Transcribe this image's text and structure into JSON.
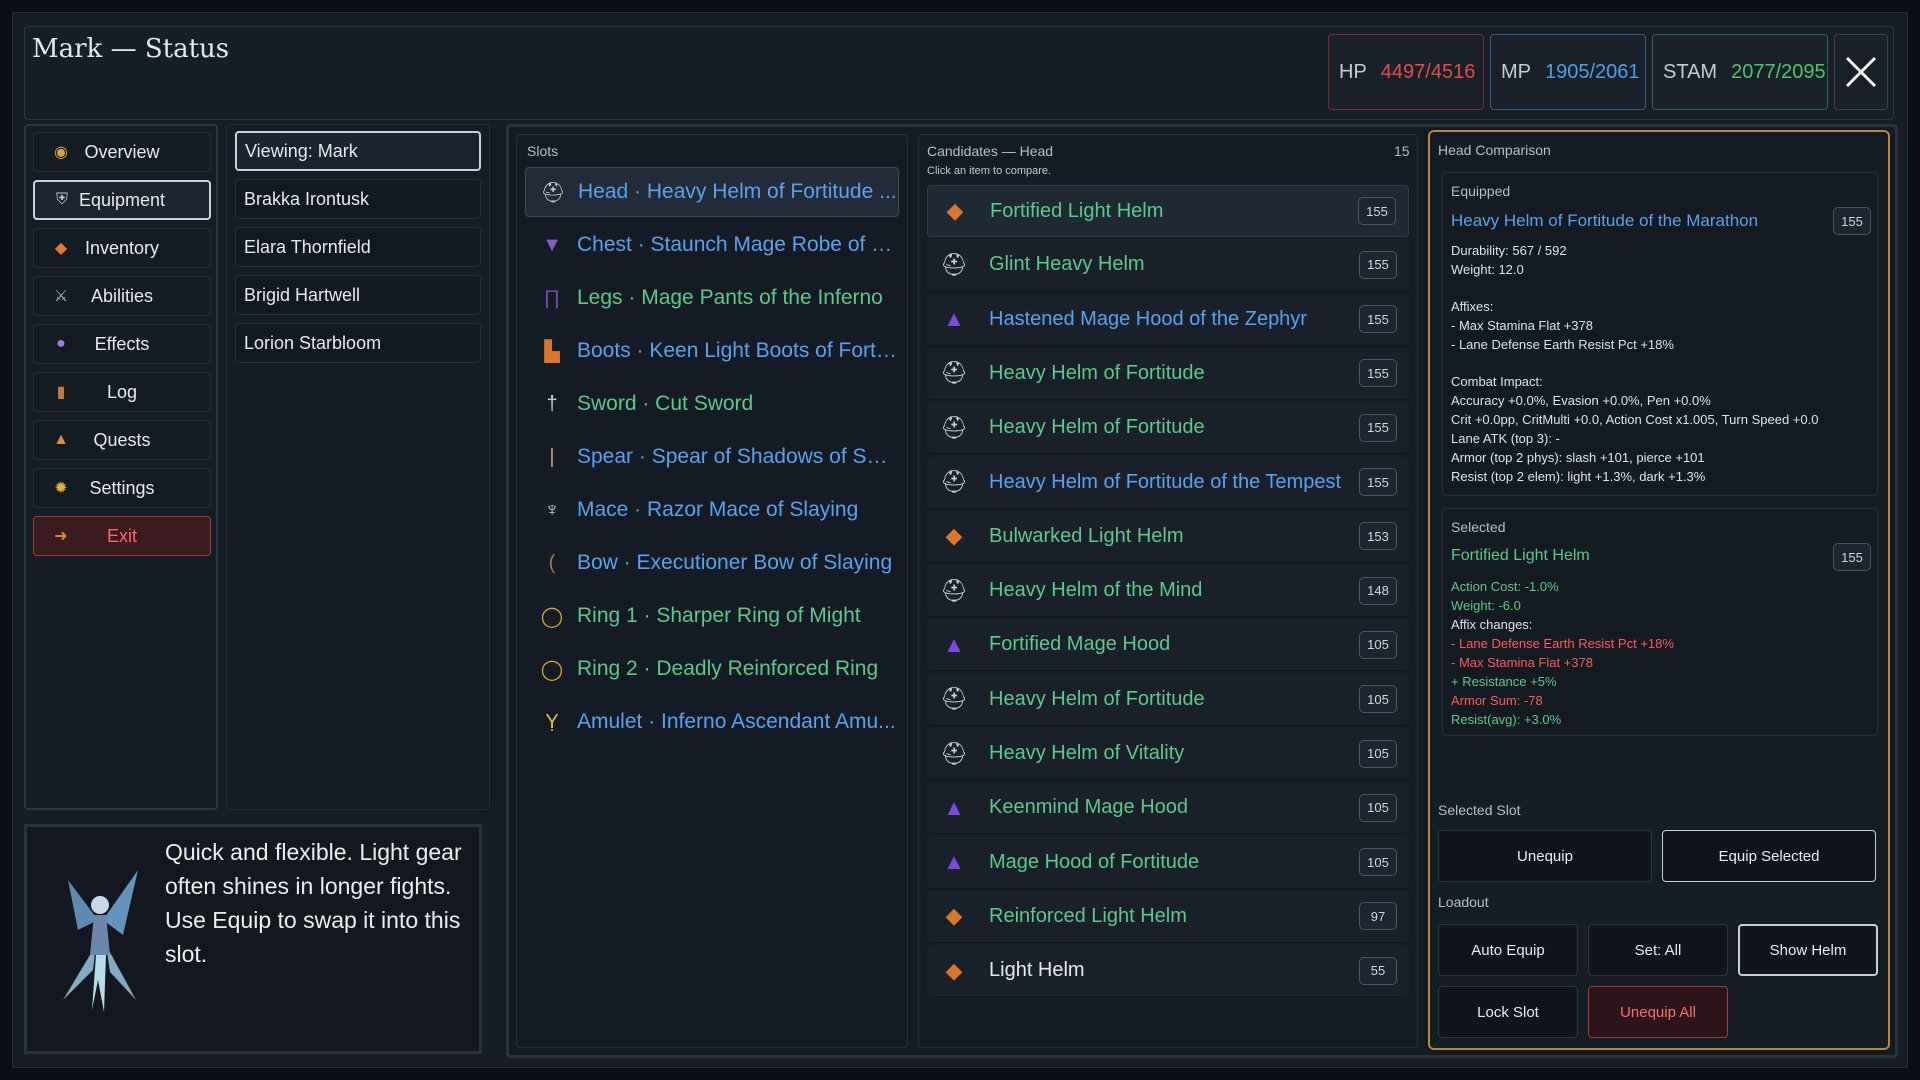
{
  "header": {
    "title": "Mark — Status",
    "hp": {
      "label": "HP",
      "value": "4497/4516",
      "color": "#e24c4c"
    },
    "mp": {
      "label": "MP",
      "value": "1905/2061",
      "color": "#4f9fe6"
    },
    "stam": {
      "label": "STAM",
      "value": "2077/2095",
      "color": "#48c868"
    },
    "close_icon": "close-icon"
  },
  "nav": {
    "items": [
      {
        "label": "Overview",
        "icon": "compass-icon"
      },
      {
        "label": "Equipment",
        "icon": "armor-icon"
      },
      {
        "label": "Inventory",
        "icon": "bag-icon"
      },
      {
        "label": "Abilities",
        "icon": "scroll-icon"
      },
      {
        "label": "Effects",
        "icon": "orb-icon"
      },
      {
        "label": "Log",
        "icon": "book-icon"
      },
      {
        "label": "Quests",
        "icon": "quest-icon"
      },
      {
        "label": "Settings",
        "icon": "gear-icon"
      },
      {
        "label": "Exit",
        "icon": "exit-icon"
      }
    ],
    "active": "Equipment"
  },
  "party": {
    "items": [
      "Viewing: Mark",
      "Brakka Irontusk",
      "Elara Thornfield",
      "Brigid Hartwell",
      "Lorion Starbloom"
    ]
  },
  "description": {
    "text_line1": "Quick and flexible. Light gear often shines in longer fights.",
    "text_line2": "Use Equip to swap it into this slot."
  },
  "slots": {
    "title": "Slots",
    "items": [
      {
        "text": "Head · Heavy Helm of Fortitude ...",
        "color": "blue",
        "icon": "helm-icon"
      },
      {
        "text": "Chest · Staunch Mage Robe of Fl...",
        "color": "blue",
        "icon": "robe-icon"
      },
      {
        "text": "Legs · Mage Pants of the Inferno",
        "color": "green",
        "icon": "pants-icon"
      },
      {
        "text": "Boots · Keen Light Boots of Forti...",
        "color": "blue",
        "icon": "boots-icon"
      },
      {
        "text": "Sword · Cut Sword",
        "color": "green",
        "icon": "sword-icon"
      },
      {
        "text": "Spear · Spear of Shadows of Sun...",
        "color": "blue",
        "icon": "spear-icon"
      },
      {
        "text": "Mace · Razor Mace of Slaying",
        "color": "blue",
        "icon": "mace-icon"
      },
      {
        "text": "Bow · Executioner Bow of Slaying",
        "color": "blue",
        "icon": "bow-icon"
      },
      {
        "text": "Ring 1 · Sharper Ring of Might",
        "color": "green",
        "icon": "ring-icon"
      },
      {
        "text": "Ring 2 · Deadly Reinforced Ring",
        "color": "green",
        "icon": "ring-icon"
      },
      {
        "text": "Amulet · Inferno Ascendant Amu...",
        "color": "blue",
        "icon": "amulet-icon"
      }
    ]
  },
  "candidates": {
    "title": "Candidates — Head",
    "count": "15",
    "hint": "Click an item to compare.",
    "items": [
      {
        "name": "Fortified Light Helm",
        "value": "155",
        "color": "green",
        "icon": "light-helm-icon"
      },
      {
        "name": "Glint Heavy Helm",
        "value": "155",
        "color": "green",
        "icon": "heavy-helm-icon"
      },
      {
        "name": "Hastened Mage Hood of the Zephyr",
        "value": "155",
        "color": "blue",
        "icon": "mage-hood-icon"
      },
      {
        "name": "Heavy Helm of Fortitude",
        "value": "155",
        "color": "green",
        "icon": "heavy-helm-icon"
      },
      {
        "name": "Heavy Helm of Fortitude",
        "value": "155",
        "color": "green",
        "icon": "heavy-helm-icon"
      },
      {
        "name": "Heavy Helm of Fortitude of the Tempest",
        "value": "155",
        "color": "blue",
        "icon": "heavy-helm-icon"
      },
      {
        "name": "Bulwarked Light Helm",
        "value": "153",
        "color": "green",
        "icon": "light-helm-icon"
      },
      {
        "name": "Heavy Helm of the Mind",
        "value": "148",
        "color": "green",
        "icon": "heavy-helm-icon"
      },
      {
        "name": "Fortified Mage Hood",
        "value": "105",
        "color": "green",
        "icon": "mage-hood-icon"
      },
      {
        "name": "Heavy Helm of Fortitude",
        "value": "105",
        "color": "green",
        "icon": "heavy-helm-icon"
      },
      {
        "name": "Heavy Helm of Vitality",
        "value": "105",
        "color": "green",
        "icon": "heavy-helm-icon"
      },
      {
        "name": "Keenmind Mage Hood",
        "value": "105",
        "color": "green",
        "icon": "mage-hood-icon"
      },
      {
        "name": "Mage Hood of Fortitude",
        "value": "105",
        "color": "green",
        "icon": "mage-hood-icon"
      },
      {
        "name": "Reinforced Light Helm",
        "value": "97",
        "color": "green",
        "icon": "light-helm-icon"
      },
      {
        "name": "Light Helm",
        "value": "55",
        "color": "white",
        "icon": "light-helm-icon"
      }
    ]
  },
  "comparison": {
    "title": "Head Comparison",
    "equipped": {
      "label": "Equipped",
      "name": "Heavy Helm of Fortitude of the Marathon",
      "value": "155",
      "durability": "Durability: 567 / 592",
      "weight": "Weight: 12.0",
      "affixes_label": "Affixes:",
      "affix1": "- Max Stamina Flat +378",
      "affix2": "- Lane Defense Earth Resist Pct +18%",
      "combat_label": "Combat Impact:",
      "combat1": "Accuracy +0.0%, Evasion +0.0%, Pen +0.0%",
      "combat2": "Crit +0.0pp, CritMulti +0.0, Action Cost x1.005, Turn Speed +0.0",
      "combat3": "Lane ATK (top 3): -",
      "combat4": "Armor (top 2 phys): slash +101, pierce +101",
      "combat5": "Resist (top 2 elem): light +1.3%, dark +1.3%"
    },
    "selected": {
      "label": "Selected",
      "name": "Fortified Light Helm",
      "value": "155",
      "action_cost": "Action Cost: -1.0%",
      "weight": "Weight: -6.0",
      "affix_changes_label": "Affix changes:",
      "change1": "- Lane Defense Earth Resist Pct +18%",
      "change2": "- Max Stamina Flat +378",
      "change3": "+ Resistance +5%",
      "armor_sum": "Armor Sum: -78",
      "resist_avg": "Resist(avg): +3.0%"
    },
    "selected_slot_label": "Selected Slot",
    "unequip": "Unequip",
    "equip_selected": "Equip Selected",
    "loadout_label": "Loadout",
    "auto_equip": "Auto Equip",
    "set_all": "Set: All",
    "show_helm": "Show Helm",
    "lock_slot": "Lock Slot",
    "unequip_all": "Unequip All"
  }
}
